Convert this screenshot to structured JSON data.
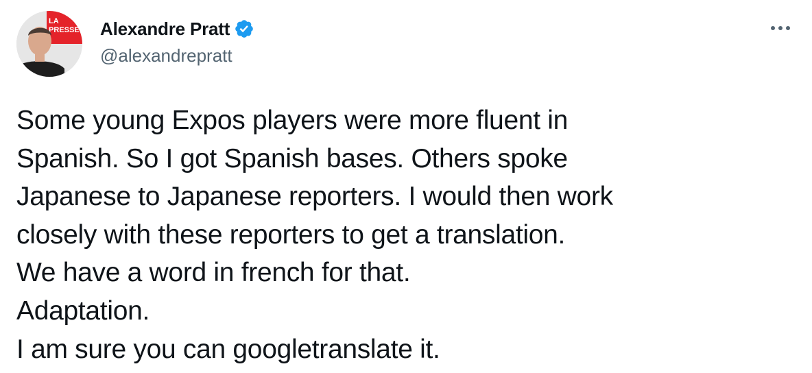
{
  "author": {
    "display_name": "Alexandre Pratt",
    "handle": "@alexandrepratt",
    "verified": true,
    "avatar_logo_text_top": "LA",
    "avatar_logo_text_bottom": "PRESSE",
    "avatar_logo_color": "#e4232a"
  },
  "icons": {
    "verified": "verified-badge-icon",
    "more": "more-options-icon"
  },
  "colors": {
    "verified_badge": "#1d9bf0",
    "handle": "#536471",
    "text": "#0f1419"
  },
  "tweet": {
    "lines": [
      "Some young Expos players were more fluent in",
      "Spanish. So I got Spanish bases. Others spoke",
      "Japanese to Japanese reporters. I would then work",
      "closely with these reporters to get a translation.",
      "We have a word in french for that.",
      "Adaptation.",
      "I am sure you can googletranslate it."
    ]
  }
}
